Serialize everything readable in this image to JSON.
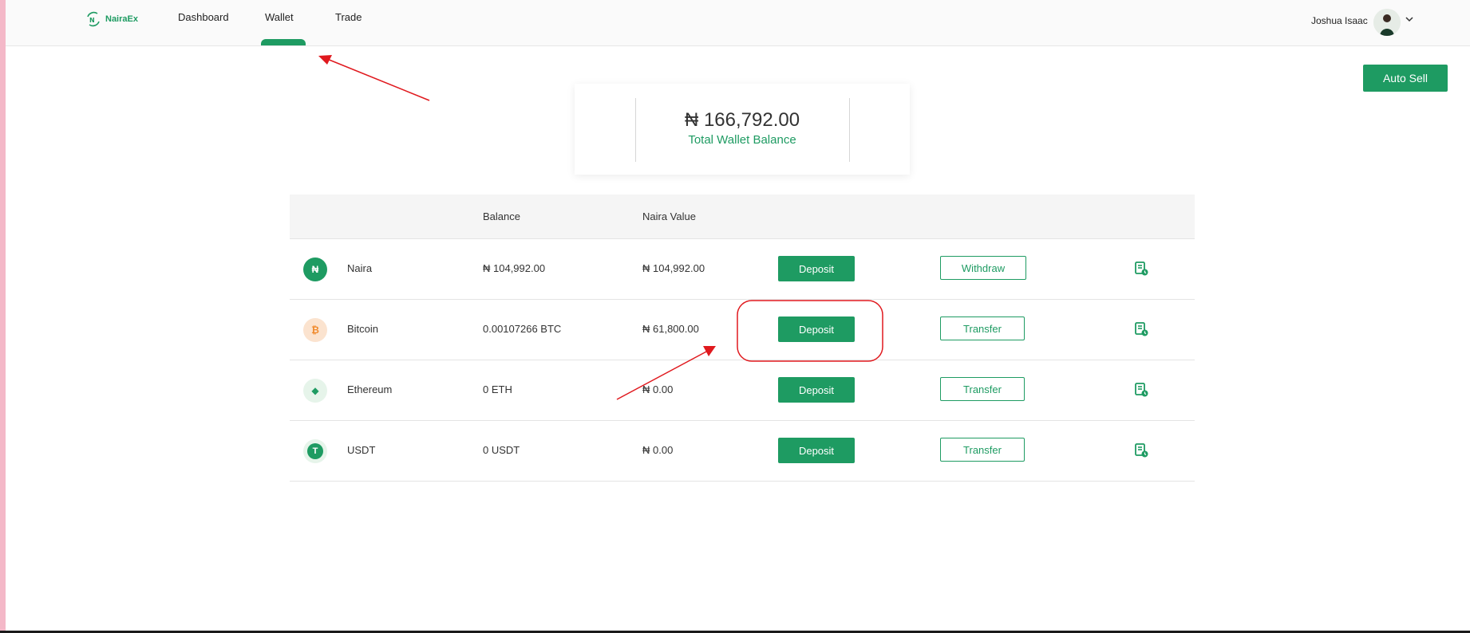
{
  "brand": {
    "name": "NairaEx"
  },
  "nav": {
    "items": [
      {
        "label": "Dashboard"
      },
      {
        "label": "Wallet"
      },
      {
        "label": "Trade"
      }
    ],
    "active": "Wallet"
  },
  "user": {
    "name": "Joshua Isaac"
  },
  "actions": {
    "auto_sell": "Auto Sell"
  },
  "summary": {
    "total_balance": "₦ 166,792.00",
    "total_label": "Total Wallet Balance"
  },
  "table": {
    "headers": {
      "balance": "Balance",
      "naira_value": "Naira Value"
    },
    "rows": [
      {
        "name": "Naira",
        "icon_glyph": "₦",
        "icon": "naira-icon",
        "balance": "₦ 104,992.00",
        "naira_value": "₦ 104,992.00",
        "deposit": "Deposit",
        "secondary": "Withdraw"
      },
      {
        "name": "Bitcoin",
        "icon_glyph": "₿",
        "icon": "bitcoin-icon",
        "balance": "0.00107266 BTC",
        "naira_value": "₦ 61,800.00",
        "deposit": "Deposit",
        "secondary": "Transfer"
      },
      {
        "name": "Ethereum",
        "icon_glyph": "◆",
        "icon": "ethereum-icon",
        "balance": "0 ETH",
        "naira_value": "₦ 0.00",
        "deposit": "Deposit",
        "secondary": "Transfer"
      },
      {
        "name": "USDT",
        "icon_glyph": "T",
        "icon": "tether-icon",
        "balance": "0 USDT",
        "naira_value": "₦ 0.00",
        "deposit": "Deposit",
        "secondary": "Transfer"
      }
    ]
  },
  "colors": {
    "accent": "#1e9b62",
    "annotation": "#e0191e"
  }
}
